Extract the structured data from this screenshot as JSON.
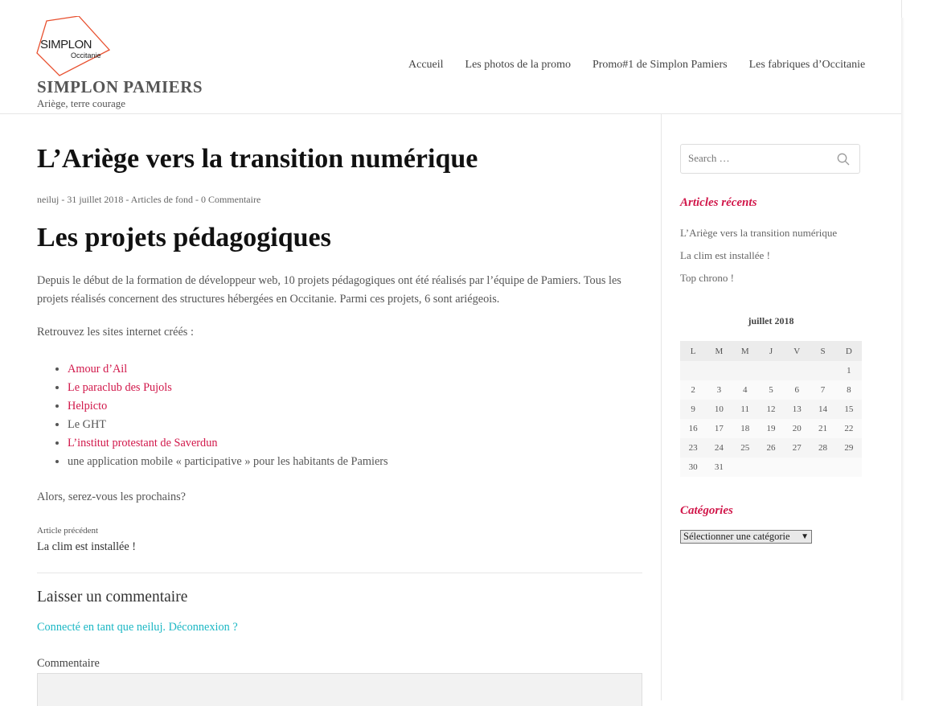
{
  "header": {
    "logo_text": "SIMPLON",
    "logo_subtext": "Occitanie",
    "site_title": "SIMPLON PAMIERS",
    "tagline": "Ariège, terre courage",
    "nav": [
      "Accueil",
      "Les photos de la promo",
      "Promo#1 de Simplon Pamiers",
      "Les fabriques d’Occitanie"
    ]
  },
  "post": {
    "title": "L’Ariège vers la transition numérique",
    "meta": "neiluj - 31 juillet 2018 - Articles de fond - 0 Commentaire",
    "section_title": "Les projets pédagogiques",
    "para1": "Depuis le début de la formation de développeur web, 10 projets pédagogiques ont été réalisés par l’équipe de Pamiers. Tous les projets réalisés concernent des structures hébergées en Occitanie. Parmi ces projets, 6 sont ariégeois.",
    "para2": "Retrouvez les sites internet créés :",
    "sites": [
      {
        "label": "Amour d’Ail",
        "link": true
      },
      {
        "label": "Le paraclub des Pujols",
        "link": true
      },
      {
        "label": "Helpicto",
        "link": true
      },
      {
        "label": "Le GHT",
        "link": false
      },
      {
        "label": "L’institut protestant de Saverdun",
        "link": true
      },
      {
        "label": "une application mobile « participative » pour les habitants de Pamiers",
        "link": false
      }
    ],
    "para3": "Alors, serez-vous les prochains?",
    "prev_label": "Article précédent",
    "prev_title": "La clim est installée !"
  },
  "comments": {
    "title": "Laisser un commentaire",
    "logged_in": "Connecté en tant que neiluj. Déconnexion ?",
    "comment_label": "Commentaire"
  },
  "sidebar": {
    "search_placeholder": "Search …",
    "recent_title": "Articles récents",
    "recent": [
      "L’Ariège vers la transition numérique",
      "La clim est installée !",
      "Top chrono !"
    ],
    "calendar": {
      "caption": "juillet 2018",
      "days": [
        "L",
        "M",
        "M",
        "J",
        "V",
        "S",
        "D"
      ],
      "weeks": [
        [
          "",
          "",
          "",
          "",
          "",
          "",
          "1"
        ],
        [
          "2",
          "3",
          "4",
          "5",
          "6",
          "7",
          "8"
        ],
        [
          "9",
          "10",
          "11",
          "12",
          "13",
          "14",
          "15"
        ],
        [
          "16",
          "17",
          "18",
          "19",
          "20",
          "21",
          "22"
        ],
        [
          "23",
          "24",
          "25",
          "26",
          "27",
          "28",
          "29"
        ],
        [
          "30",
          "31",
          "",
          "",
          "",
          "",
          ""
        ]
      ]
    },
    "categories_title": "Catégories",
    "categories_select": "Sélectionner une catégorie"
  },
  "colors": {
    "accent": "#d1174a",
    "link_teal": "#1bb7c4",
    "logo_red": "#e8502f"
  },
  "icons": {
    "search": "search-icon",
    "dropdown": "chevron-down-icon"
  }
}
